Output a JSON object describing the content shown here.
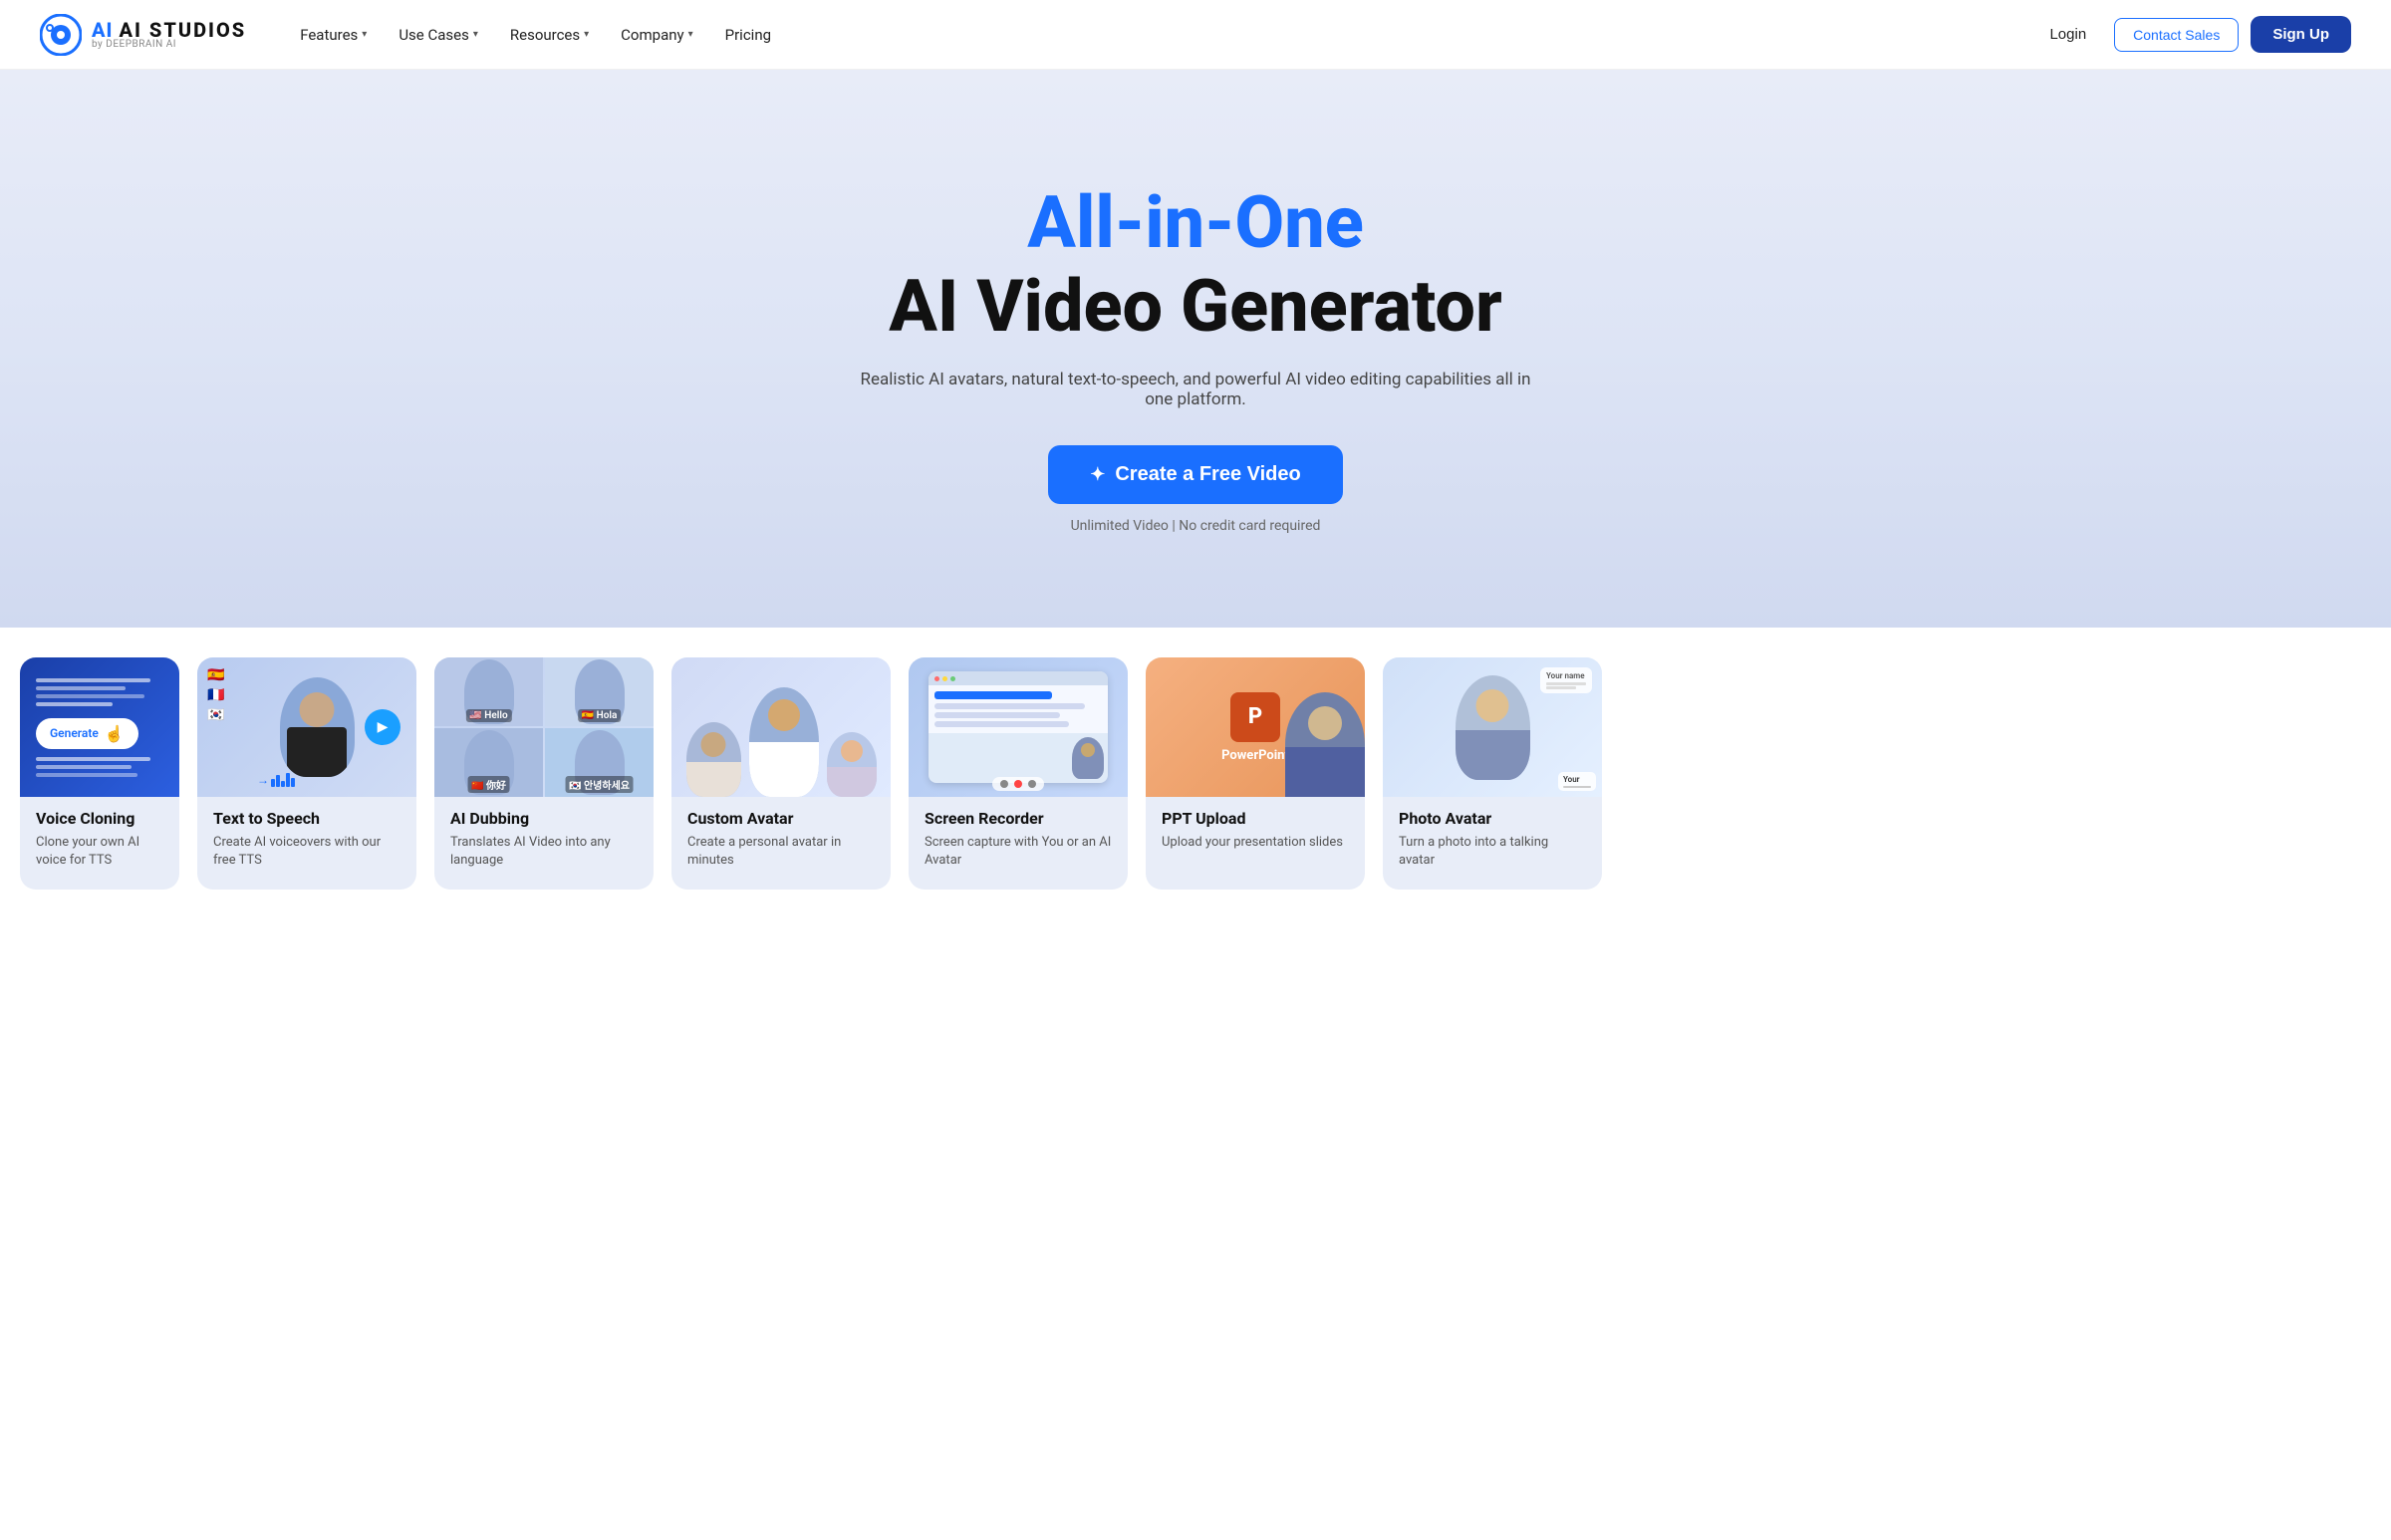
{
  "navbar": {
    "logo_main": "AI STUDIOS",
    "logo_sub": "by DEEPBRAIN AI",
    "nav_items": [
      {
        "label": "Features",
        "has_dropdown": true
      },
      {
        "label": "Use Cases",
        "has_dropdown": true
      },
      {
        "label": "Resources",
        "has_dropdown": true
      },
      {
        "label": "Company",
        "has_dropdown": true
      },
      {
        "label": "Pricing",
        "has_dropdown": false
      }
    ],
    "login_label": "Login",
    "contact_label": "Contact Sales",
    "signup_label": "Sign Up"
  },
  "hero": {
    "title_blue": "All-in-One",
    "title_black": "AI Video Generator",
    "subtitle": "Realistic AI avatars, natural text-to-speech, and powerful AI video editing capabilities all in one platform.",
    "cta_label": "Create a Free Video",
    "note": "Unlimited Video | No credit card required"
  },
  "cards": [
    {
      "id": "voice-cloning",
      "type": "voice",
      "title": "Voice Cloning",
      "desc": "Clone your own AI voice for TTS"
    },
    {
      "id": "text-to-speech",
      "type": "tts",
      "title": "Text to Speech",
      "desc": "Create AI voiceovers with our free TTS"
    },
    {
      "id": "ai-dubbing",
      "type": "dubbing",
      "title": "AI Dubbing",
      "desc": "Translates AI Video into any language"
    },
    {
      "id": "custom-avatar",
      "type": "avatar",
      "title": "Custom Avatar",
      "desc": "Create a personal avatar in minutes"
    },
    {
      "id": "screen-recorder",
      "type": "screen",
      "title": "Screen Recorder",
      "desc": "Screen capture with You or an AI Avatar"
    },
    {
      "id": "ppt-upload",
      "type": "ppt",
      "title": "PPT Upload",
      "desc": "Upload your presentation slides"
    },
    {
      "id": "photo-avatar",
      "type": "photo",
      "title": "Photo Avatar",
      "desc": "Turn a photo into a talking avatar"
    }
  ],
  "icons": {
    "sparkle": "✦",
    "play": "▶",
    "chevron_down": "▾"
  }
}
